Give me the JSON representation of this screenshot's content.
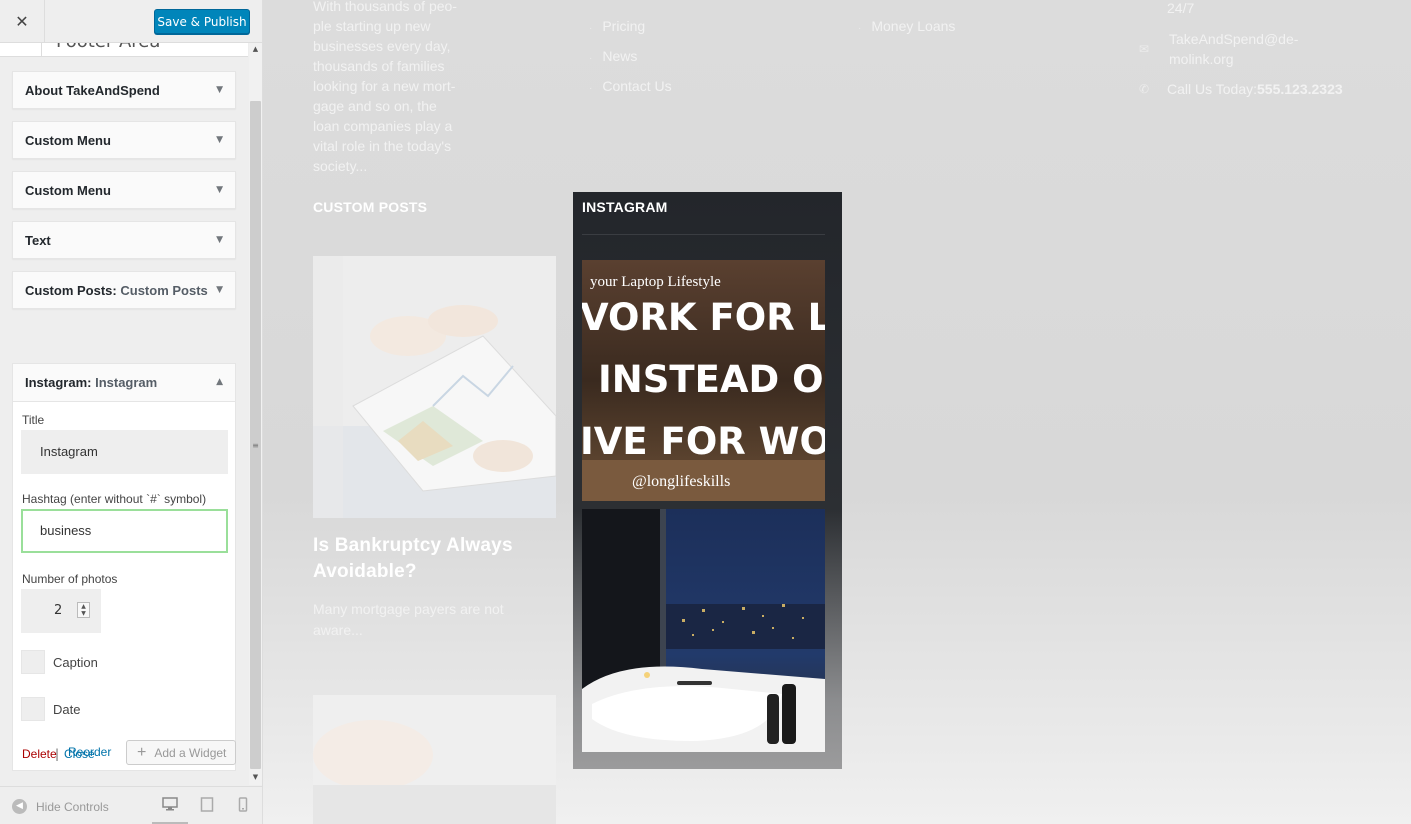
{
  "topbar": {
    "close_glyph": "✕",
    "save_label": "Save & Publish"
  },
  "section": {
    "title": "Footer Area"
  },
  "widgets": [
    {
      "title": "About TakeAndSpend",
      "sub": ""
    },
    {
      "title": "Custom Menu",
      "sub": ""
    },
    {
      "title": "Custom Menu",
      "sub": ""
    },
    {
      "title": "Text",
      "sub": ""
    },
    {
      "title": "Custom Posts:",
      "sub": "Custom Posts"
    },
    {
      "title": "Instagram:",
      "sub": "Instagram"
    }
  ],
  "form": {
    "title_label": "Title",
    "title_value": "Instagram",
    "hashtag_label": "Hashtag (enter without `#` symbol)",
    "hashtag_value": "business",
    "photos_label": "Number of photos",
    "photos_value": "2",
    "caption_label": "Caption",
    "date_label": "Date",
    "delete_label": "Delete",
    "separator": "|",
    "close_label": "Close"
  },
  "actions": {
    "reorder_label": "Reorder",
    "add_widget_label": "Add a Widget"
  },
  "footer": {
    "hide_label": "Hide Controls"
  },
  "preview": {
    "about_lines": [
      "With thousands of peo-",
      "ple starting up new",
      "businesses every day,",
      "thousands of families",
      "looking for a new mort-",
      "gage and so on, the",
      "loan companies play a",
      "vital role in the today's",
      "society..."
    ],
    "menu_items": [
      "Pricing",
      "News",
      "Contact Us"
    ],
    "menu2_items": [
      "Money Loans"
    ],
    "contact_247": "24/7",
    "contact_email_line1": "TakeAndSpend@de-",
    "contact_email_line2": "molink.org",
    "contact_call_prefix": "Call Us Today:",
    "contact_phone": "555.123.2323",
    "custom_posts_heading": "CUSTOM POSTS",
    "post_title_line1": "Is Bankruptcy Always",
    "post_title_line2": "Avoidable?",
    "post_excerpt_line1": "Many mortgage payers are not",
    "post_excerpt_line2": "aware...",
    "instagram_heading": "INSTAGRAM",
    "photo1_lines": [
      "your Laptop Lifestyle",
      "VORK FOR LIVE",
      "INSTEAD OF",
      "IVE FOR WORK",
      "@longlifeskills"
    ]
  },
  "colors": {
    "accent": "#0085ba",
    "link": "#0073aa",
    "delete": "#a00000",
    "focus_border": "#9adf9a",
    "instagram_bg": "#23262b"
  }
}
